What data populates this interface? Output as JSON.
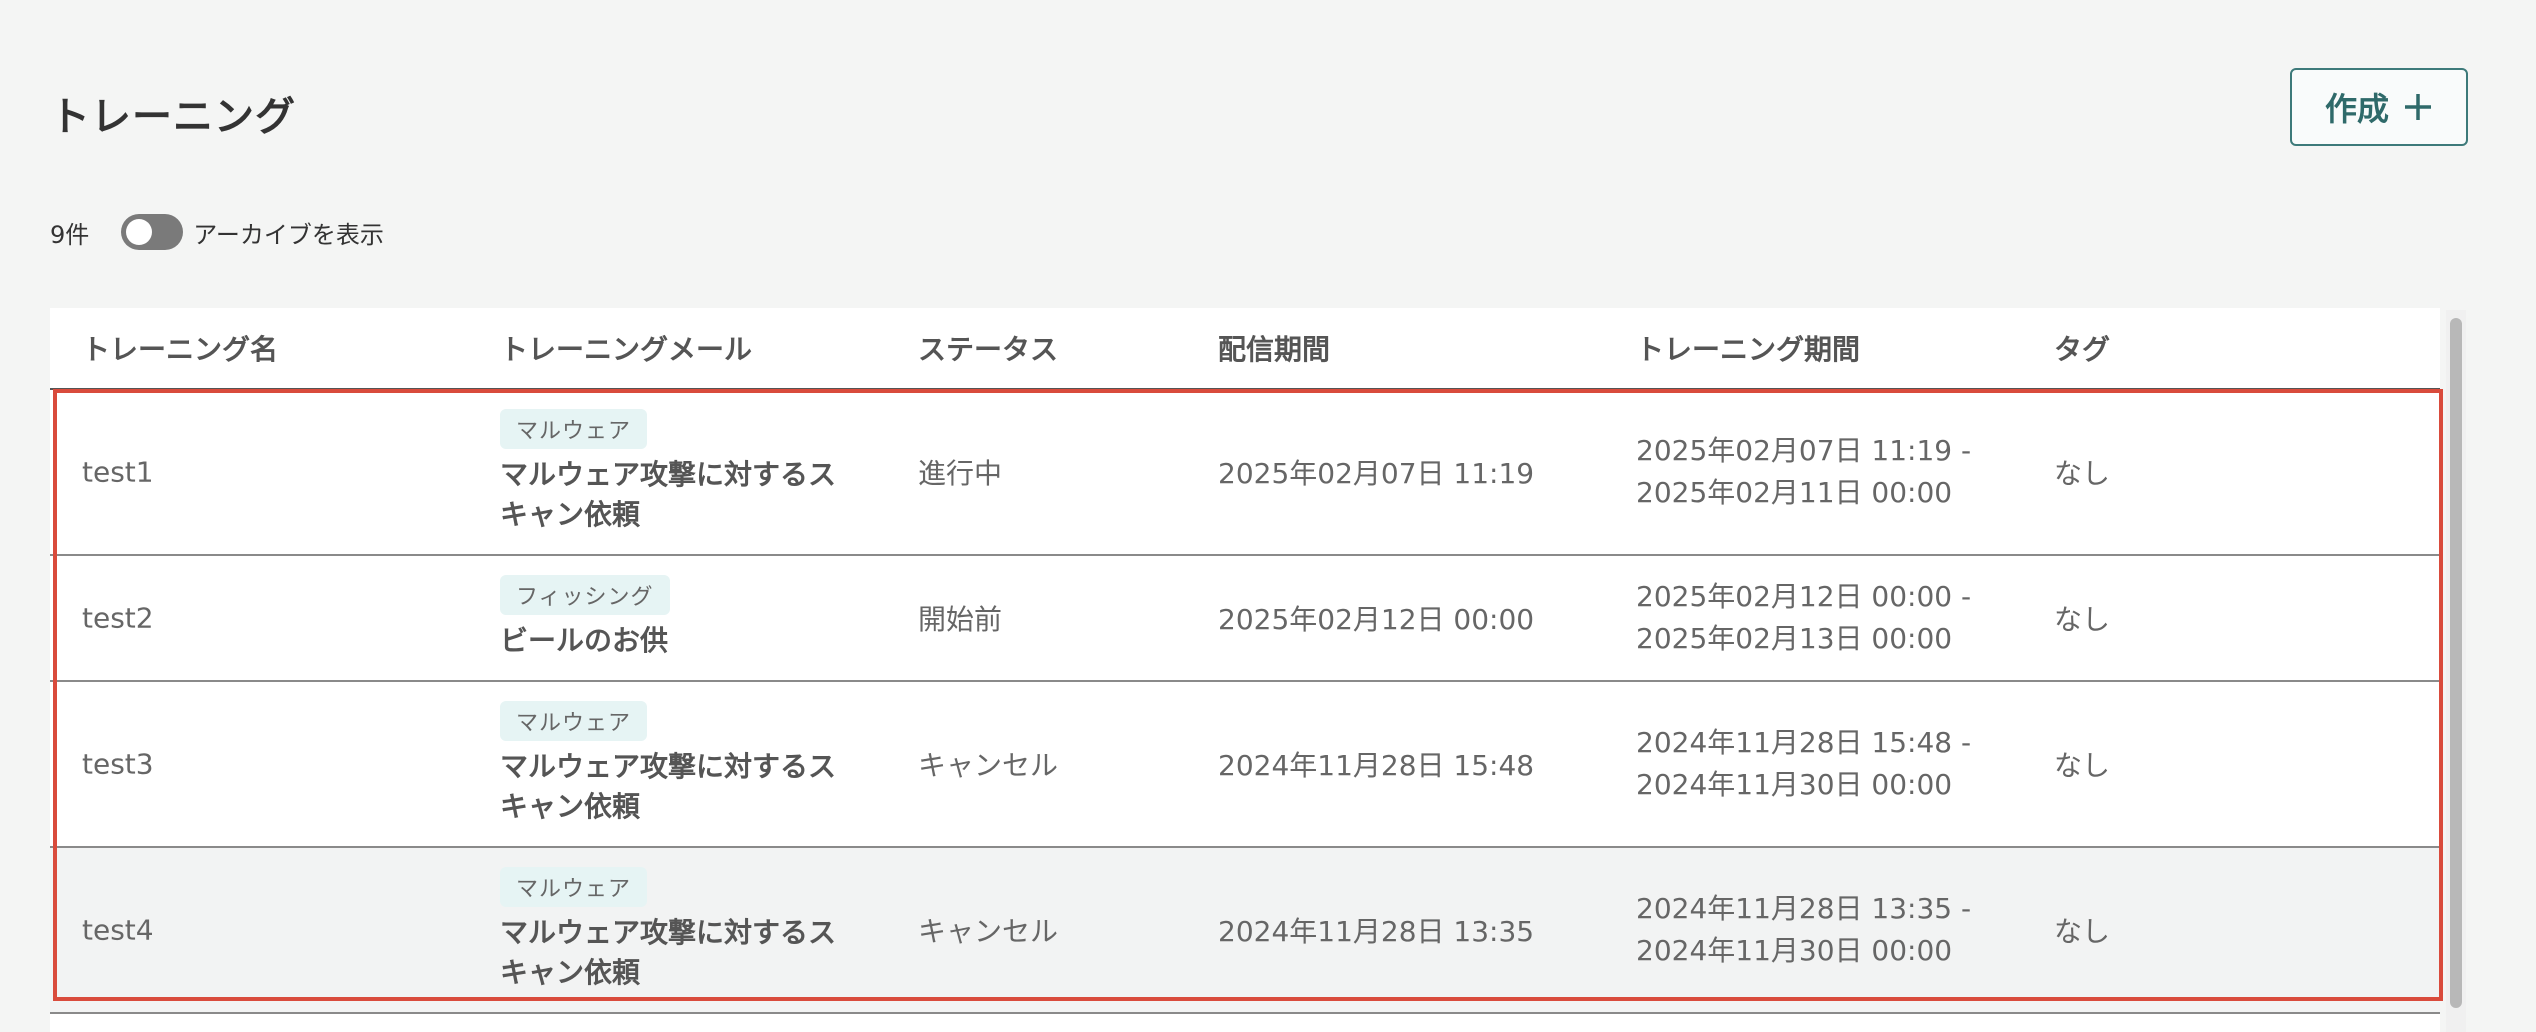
{
  "page": {
    "title": "トレーニング"
  },
  "toolbar": {
    "create_label": "作成"
  },
  "filter": {
    "count": "9件",
    "archive_toggle_label": "アーカイブを表示",
    "archive_toggle_on": false
  },
  "table": {
    "headers": {
      "name": "トレーニング名",
      "mail": "トレーニングメール",
      "status": "ステータス",
      "delivery": "配信期間",
      "period": "トレーニング期間",
      "tag": "タグ"
    },
    "rows": [
      {
        "name": "test1",
        "mail_tag": "マルウェア",
        "mail_title_l1": "マルウェア攻撃に対するス",
        "mail_title_l2": "キャン依頼",
        "status": "進行中",
        "delivery": "2025年02月07日 11:19",
        "period_start": "2025年02月07日 11:19 -",
        "period_end": "2025年02月11日 00:00",
        "tag": "なし"
      },
      {
        "name": "test2",
        "mail_tag": "フィッシング",
        "mail_title_l1": "ビールのお供",
        "mail_title_l2": "",
        "status": "開始前",
        "delivery": "2025年02月12日 00:00",
        "period_start": "2025年02月12日 00:00 -",
        "period_end": "2025年02月13日 00:00",
        "tag": "なし"
      },
      {
        "name": "test3",
        "mail_tag": "マルウェア",
        "mail_title_l1": "マルウェア攻撃に対するス",
        "mail_title_l2": "キャン依頼",
        "status": "キャンセル",
        "delivery": "2024年11月28日 15:48",
        "period_start": "2024年11月28日 15:48 -",
        "period_end": "2024年11月30日 00:00",
        "tag": "なし"
      },
      {
        "name": "test4",
        "mail_tag": "マルウェア",
        "mail_title_l1": "マルウェア攻撃に対するス",
        "mail_title_l2": "キャン依頼",
        "status": "キャンセル",
        "delivery": "2024年11月28日 13:35",
        "period_start": "2024年11月28日 13:35 -",
        "period_end": "2024年11月30日 00:00",
        "tag": "なし"
      }
    ]
  },
  "colors": {
    "background": "#f4f5f4",
    "accent": "#2f6a6a",
    "highlight": "#d94b3c",
    "chip": "#e6f4f4"
  },
  "icons": {
    "create": "plus-icon"
  }
}
